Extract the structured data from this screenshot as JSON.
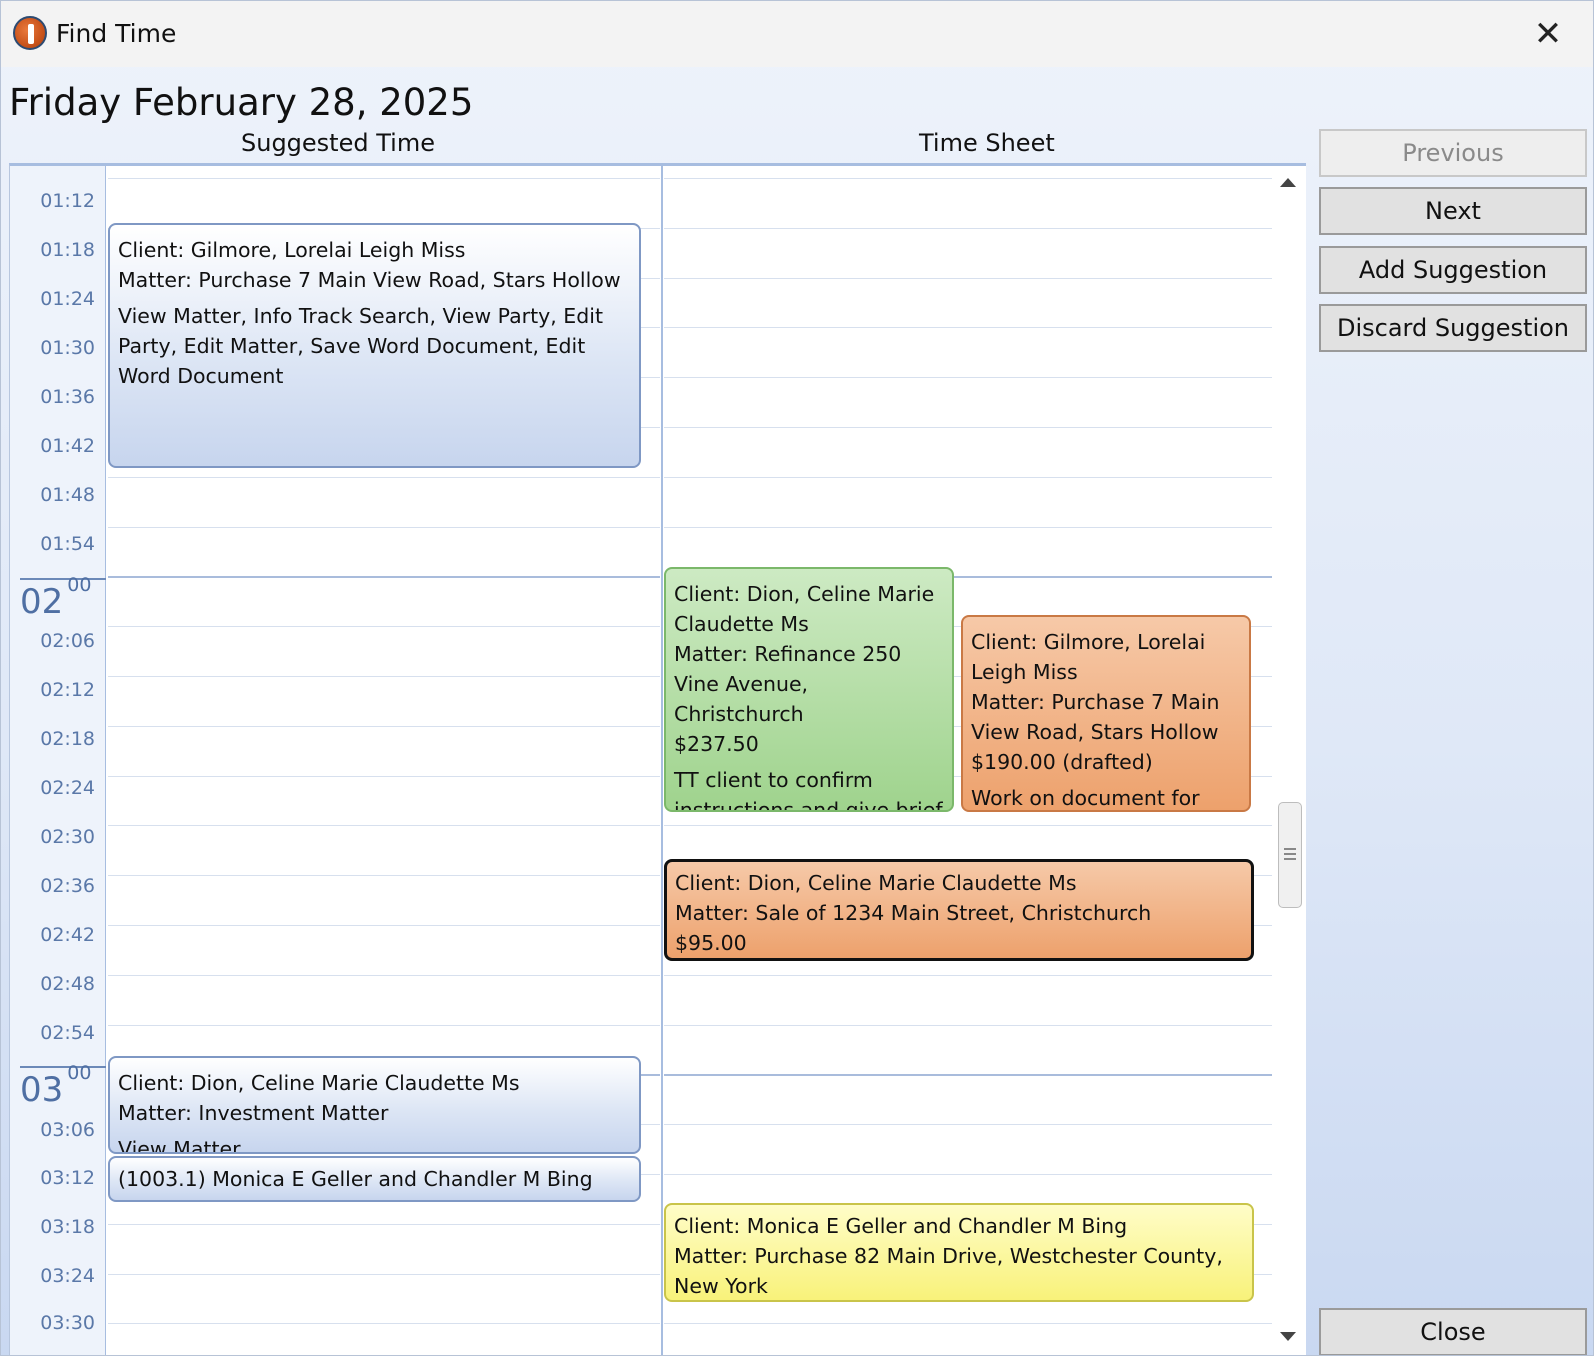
{
  "window": {
    "title": "Find Time",
    "close_glyph": "✕"
  },
  "date_title": "Friday February 28, 2025",
  "columns": {
    "suggested": "Suggested Time",
    "timesheet": "Time Sheet"
  },
  "time_labels": [
    "01:12",
    "01:18",
    "01:24",
    "01:30",
    "01:36",
    "01:42",
    "01:48",
    "01:54",
    "02:06",
    "02:12",
    "02:18",
    "02:24",
    "02:30",
    "02:36",
    "02:42",
    "02:48",
    "02:54",
    "03:06",
    "03:12",
    "03:18",
    "03:24",
    "03:30"
  ],
  "hour_labels": [
    {
      "hour": "02",
      "min": "00"
    },
    {
      "hour": "03",
      "min": "00"
    }
  ],
  "suggested": [
    {
      "line1": "Client: Gilmore, Lorelai Leigh Miss",
      "line2": "Matter: Purchase 7 Main View Road, Stars Hollow",
      "line3": "View Matter, Info Track Search, View Party, Edit Party, Edit Matter, Save Word Document, Edit Word Document"
    },
    {
      "line1": "Client: Dion, Celine Marie Claudette Ms",
      "line2": "Matter: Investment Matter",
      "line3": "View Matter"
    },
    {
      "line1": "(1003.1) Monica E Geller and Chandler M Bing"
    }
  ],
  "timesheet": [
    {
      "line1": "Client: Dion, Celine Marie Claudette Ms",
      "line2": "Matter: Refinance 250 Vine Avenue, Christchurch",
      "line3": "$237.50",
      "line4": "TT client to confirm instructions and give brief overview of the bank"
    },
    {
      "line1": "Client: Gilmore, Lorelai Leigh Miss",
      "line2": "Matter: Purchase 7 Main View Road, Stars Hollow",
      "line3": "$190.00 (drafted)",
      "line4": "Work on document for"
    },
    {
      "line1": "Client: Dion, Celine Marie Claudette Ms",
      "line2": "Matter: Sale of 1234 Main Street, Christchurch",
      "line3": "$95.00"
    },
    {
      "line1": "Client: Monica E Geller and Chandler M Bing",
      "line2": "Matter: Purchase 82 Main Drive, Westchester County, New York"
    }
  ],
  "buttons": {
    "previous": "Previous",
    "next": "Next",
    "add_suggestion": "Add Suggestion",
    "discard_suggestion": "Discard Suggestion",
    "close": "Close"
  },
  "colors": {
    "accent_blue": "#a7bde0",
    "appt_green": "#9fd38d",
    "appt_orange": "#eda16c",
    "appt_yellow": "#f8f27a"
  },
  "icons": {
    "app": "app-logo-icon",
    "close": "close-icon",
    "scroll_up": "chevron-up-icon",
    "scroll_down": "chevron-down-icon"
  }
}
